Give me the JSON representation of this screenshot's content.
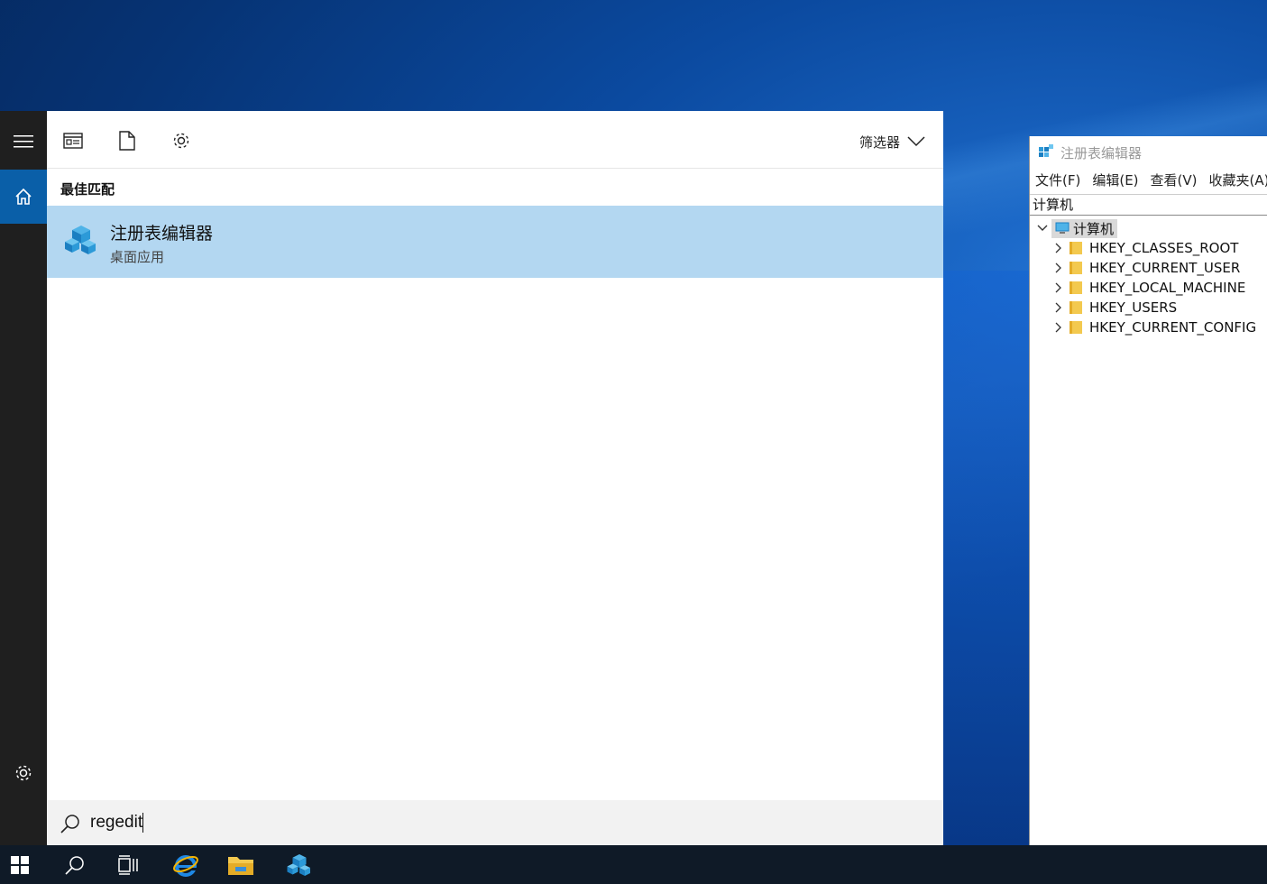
{
  "start_menu": {
    "toolbar": {
      "filter_label": "筛选器"
    },
    "section_title": "最佳匹配",
    "best_match": {
      "name": "注册表编辑器",
      "subtitle": "桌面应用"
    },
    "search": {
      "value": "regedit"
    }
  },
  "regedit": {
    "title": "注册表编辑器",
    "menu": [
      "文件(F)",
      "编辑(E)",
      "查看(V)",
      "收藏夹(A)"
    ],
    "address": "计算机",
    "tree": {
      "root": "计算机",
      "children": [
        "HKEY_CLASSES_ROOT",
        "HKEY_CURRENT_USER",
        "HKEY_LOCAL_MACHINE",
        "HKEY_USERS",
        "HKEY_CURRENT_CONFIG"
      ]
    }
  },
  "colors": {
    "highlight": "#b3d7f1",
    "accent": "#0a5fa8",
    "rail": "#1f1f1f",
    "taskbar": "#0f1a27"
  }
}
